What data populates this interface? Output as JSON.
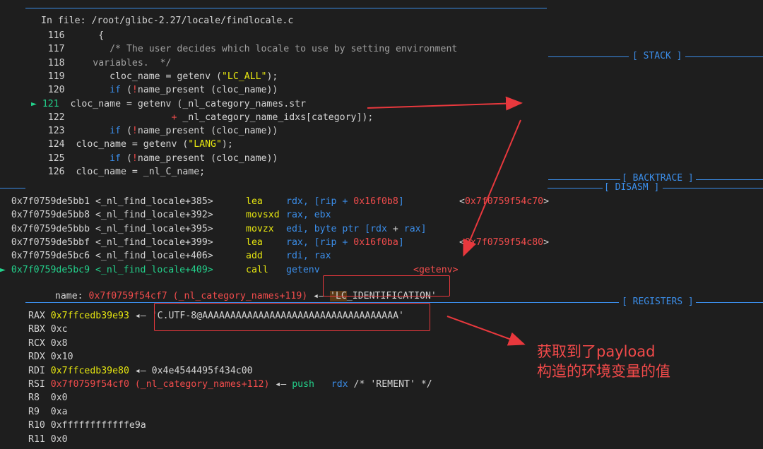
{
  "source": {
    "file_label": "In file: /root/glibc-2.27/locale/findlocale.c",
    "lines": [
      {
        "n": "116",
        "parts": [
          [
            "    {",
            "sym"
          ]
        ]
      },
      {
        "n": "117",
        "parts": [
          [
            "      /* The user decides which locale to use by setting environment",
            "cmt"
          ]
        ]
      },
      {
        "n": "118",
        "parts": [
          [
            "   variables.  */",
            "cmt"
          ]
        ]
      },
      {
        "n": "119",
        "parts": [
          [
            "      cloc_name = ",
            "sym"
          ],
          [
            "getenv",
            "sym"
          ],
          [
            " (",
            "sym"
          ],
          [
            "\"LC_ALL\"",
            "str"
          ],
          [
            ");",
            "sym"
          ]
        ]
      },
      {
        "n": "120",
        "parts": [
          [
            "      if",
            "kw"
          ],
          [
            " (",
            "sym"
          ],
          [
            "!",
            "red"
          ],
          [
            "name_present (cloc_name))",
            "sym"
          ]
        ]
      },
      {
        "n": "121",
        "current": true,
        "parts": [
          [
            "cloc_name = getenv (_nl_category_names.str",
            "sym"
          ]
        ]
      },
      {
        "n": "122",
        "parts": [
          [
            "                 ",
            "sym"
          ],
          [
            "+",
            "red"
          ],
          [
            " _nl_category_name_idxs[category]);",
            "sym"
          ]
        ]
      },
      {
        "n": "123",
        "parts": [
          [
            "      if",
            "kw"
          ],
          [
            " (",
            "sym"
          ],
          [
            "!",
            "red"
          ],
          [
            "name_present (cloc_name))",
            "sym"
          ]
        ]
      },
      {
        "n": "124",
        "parts": [
          [
            "cloc_name = getenv (",
            "sym"
          ],
          [
            "\"LANG\"",
            "str"
          ],
          [
            ");",
            "sym"
          ]
        ]
      },
      {
        "n": "125",
        "parts": [
          [
            "      if",
            "kw"
          ],
          [
            " (",
            "sym"
          ],
          [
            "!",
            "red"
          ],
          [
            "name_present (cloc_name))",
            "sym"
          ]
        ]
      },
      {
        "n": "126",
        "parts": [
          [
            "cloc_name = _nl_C_name;",
            "sym"
          ]
        ]
      }
    ],
    "current_marker": "►"
  },
  "headers": {
    "stack": "[ STACK ]",
    "backtrace": "[ BACKTRACE ]",
    "disasm": "[ DISASM ]",
    "registers": "[ REGISTERS ]"
  },
  "disasm": [
    {
      "addr": "0x7f0759de5bb1",
      "sym": "<_nl_find_locale+385>",
      "mn": "lea",
      "ops": [
        [
          "rdx, [rip + ",
          "kw"
        ],
        [
          "0x16f0b8",
          "red"
        ],
        [
          "]",
          "kw"
        ]
      ],
      "cmt": [
        [
          "<",
          "sym"
        ],
        [
          "0x7f0759f54c70",
          "red"
        ],
        [
          ">",
          "sym"
        ]
      ]
    },
    {
      "addr": "0x7f0759de5bb8",
      "sym": "<_nl_find_locale+392>",
      "mn": "movsxd",
      "ops": [
        [
          "rax, ebx",
          "kw"
        ]
      ],
      "cmt": []
    },
    {
      "addr": "0x7f0759de5bbb",
      "sym": "<_nl_find_locale+395>",
      "mn": "movzx",
      "ops": [
        [
          "edi, byte ptr [",
          "kw"
        ],
        [
          "rdx",
          "kw"
        ],
        [
          " + ",
          "sym"
        ],
        [
          "rax",
          "kw"
        ],
        [
          "]",
          "kw"
        ]
      ],
      "cmt": []
    },
    {
      "addr": "0x7f0759de5bbf",
      "sym": "<_nl_find_locale+399>",
      "mn": "lea",
      "ops": [
        [
          "rax, [rip + ",
          "kw"
        ],
        [
          "0x16f0ba",
          "red"
        ],
        [
          "]",
          "kw"
        ]
      ],
      "cmt": [
        [
          "<",
          "sym"
        ],
        [
          "0x7f0759f54c80",
          "red"
        ],
        [
          ">",
          "sym"
        ]
      ]
    },
    {
      "addr": "0x7f0759de5bc6",
      "sym": "<_nl_find_locale+406>",
      "mn": "add",
      "ops": [
        [
          "rdi, rax",
          "kw"
        ]
      ],
      "cmt": []
    },
    {
      "addr": "0x7f0759de5bc9",
      "sym": "<_nl_find_locale+409>",
      "mn": "call",
      "ops": [
        [
          "getenv",
          "kw"
        ]
      ],
      "cmt": [
        [
          "<getenv>",
          "red"
        ]
      ],
      "current": true
    }
  ],
  "name_line": {
    "label": "name:",
    "addr": "0x7f0759f54cf7",
    "sym": "(_nl_category_names+119)",
    "arrow": "◂—",
    "value": "'LC_IDENTIFICATION'"
  },
  "registers": [
    {
      "name": "RAX",
      "parts": [
        [
          "0x7ffcedb39e93",
          "yel"
        ],
        [
          " ◂— ",
          "sym"
        ],
        [
          "'C.UTF-8@AAAAAAAAAAAAAAAAAAAAAAAAAAAAAAAAAAA'",
          "sym"
        ]
      ]
    },
    {
      "name": "RBX",
      "parts": [
        [
          "0xc",
          "sym"
        ]
      ]
    },
    {
      "name": "RCX",
      "parts": [
        [
          "0x8",
          "sym"
        ]
      ]
    },
    {
      "name": "RDX",
      "parts": [
        [
          "0x10",
          "sym"
        ]
      ]
    },
    {
      "name": "RDI",
      "parts": [
        [
          "0x7ffcedb39e80",
          "yel"
        ],
        [
          " ◂— 0x4e4544495f434c00",
          "sym"
        ]
      ]
    },
    {
      "name": "RSI",
      "parts": [
        [
          "0x7f0759f54cf0",
          "red"
        ],
        [
          " (_nl_category_names+112)",
          "red"
        ],
        [
          " ◂— ",
          "sym"
        ],
        [
          "push",
          "green"
        ],
        [
          "   ",
          "sym"
        ],
        [
          "rdx",
          "kw"
        ],
        [
          " /* 'REMENT' */",
          "sym"
        ]
      ]
    },
    {
      "name": "R8",
      "parts": [
        [
          "0x0",
          "sym"
        ]
      ]
    },
    {
      "name": "R9",
      "parts": [
        [
          "0xa",
          "sym"
        ]
      ]
    },
    {
      "name": "R10",
      "parts": [
        [
          "0xffffffffffffe9a",
          "sym"
        ]
      ]
    },
    {
      "name": "R11",
      "parts": [
        [
          "0x0",
          "sym"
        ]
      ]
    }
  ],
  "annotation": {
    "line1": "获取到了payload",
    "line2": "构造的环境变量的值"
  }
}
